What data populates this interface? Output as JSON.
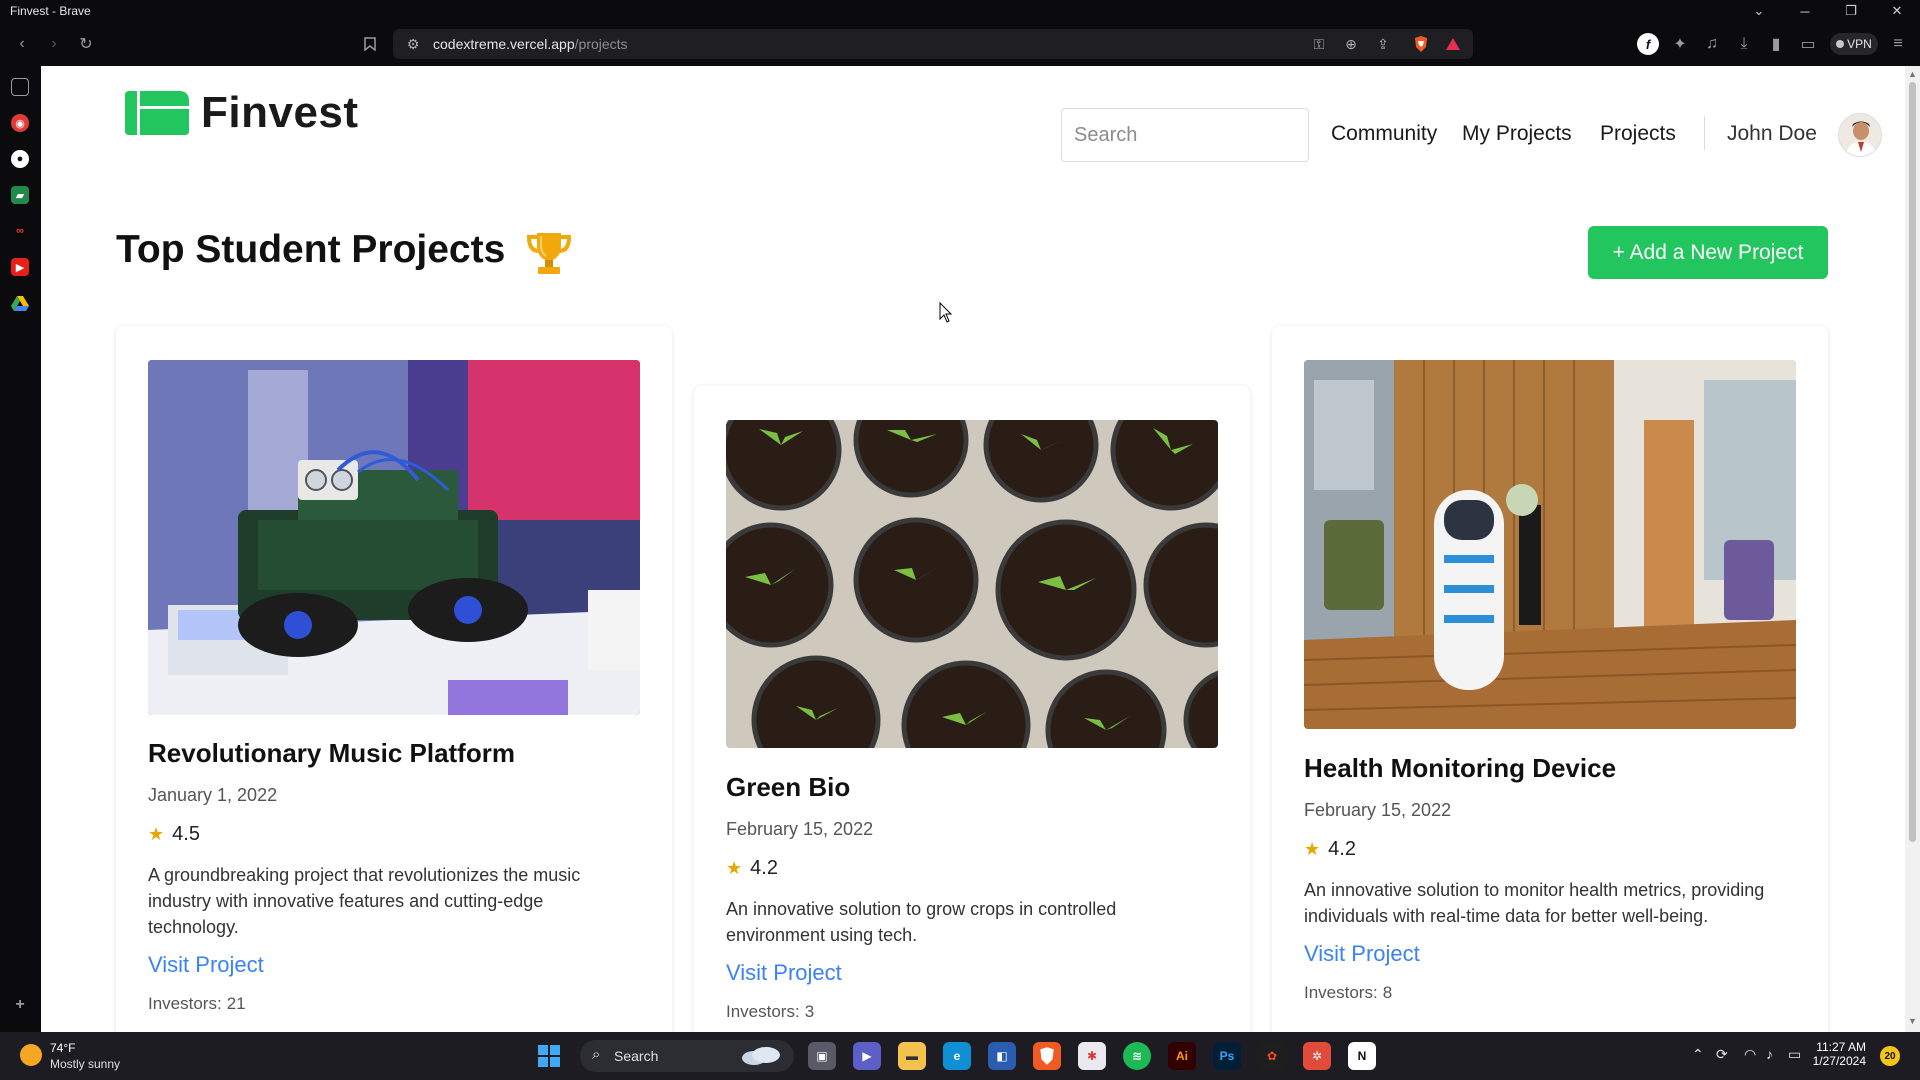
{
  "window": {
    "title": "Finvest - Brave"
  },
  "browser": {
    "url_host": "codextreme.vercel.app",
    "url_path": "/projects",
    "vpn_label": "VPN"
  },
  "header": {
    "logo_text": "Finvest",
    "search_placeholder": "Search",
    "nav": [
      "Community",
      "My Projects",
      "Projects"
    ],
    "user_name": "John Doe"
  },
  "main": {
    "title": "Top Student Projects",
    "add_button": "+ Add a New Project",
    "projects": [
      {
        "title": "Revolutionary Music Platform",
        "date": "January 1, 2022",
        "rating": "4.5",
        "description": "A groundbreaking project that revolutionizes the music industry with innovative features and cutting-edge technology.",
        "link": "Visit Project",
        "investors_label": "Investors:",
        "investors": "21"
      },
      {
        "title": "Green Bio",
        "date": "February 15, 2022",
        "rating": "4.2",
        "description": "An innovative solution to grow crops in controlled environment using tech.",
        "link": "Visit Project",
        "investors_label": "Investors:",
        "investors": "3"
      },
      {
        "title": "Health Monitoring Device",
        "date": "February 15, 2022",
        "rating": "4.2",
        "description": "An innovative solution to monitor health metrics, providing individuals with real-time data for better well-being.",
        "link": "Visit Project",
        "investors_label": "Investors:",
        "investors": "8"
      }
    ]
  },
  "taskbar": {
    "weather_temp": "74°F",
    "weather_cond": "Mostly sunny",
    "search_label": "Search",
    "time": "11:27 AM",
    "date": "1/27/2024",
    "notification_count": "20"
  },
  "colors": {
    "brand_green": "#22c55e",
    "link_blue": "#3b82f6",
    "star": "#e6a700"
  }
}
